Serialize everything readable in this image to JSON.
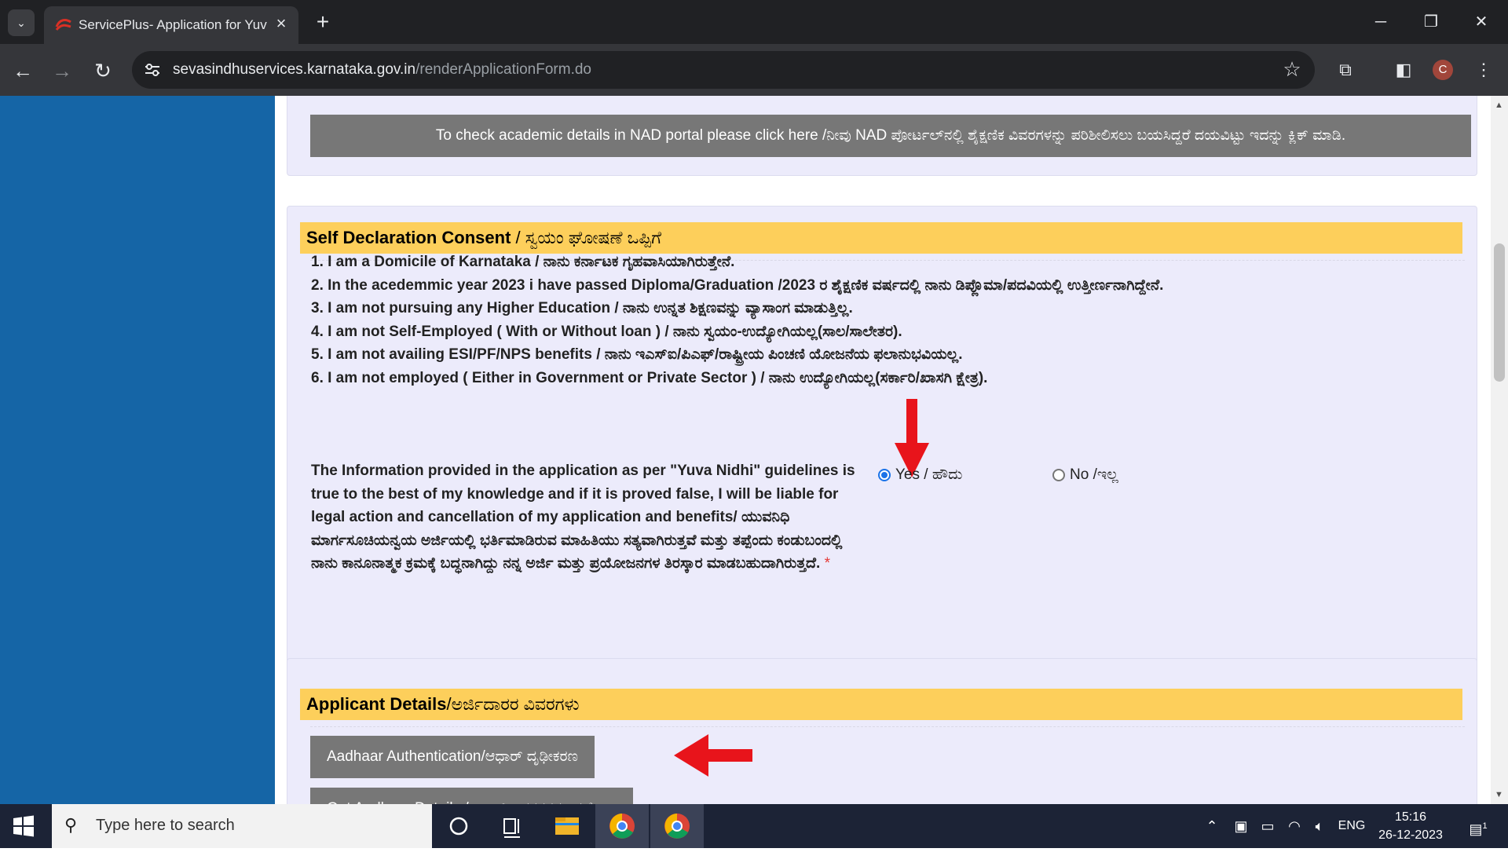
{
  "browser": {
    "tab_title": "ServicePlus- Application for Yuva Nidhi",
    "url_domain": "sevasindhuservices.karnataka.gov.in",
    "url_path": "/renderApplicationForm.do",
    "profile_initial": "C"
  },
  "nad": {
    "button_label": "To check academic details in NAD portal please click here /ನೀವು NAD ಪೋರ್ಟಲ್‌ನಲ್ಲಿ ಶೈಕ್ಷಣಿಕ ವಿವರಗಳನ್ನು ಪರಿಶೀಲಿಸಲು ಬಯಸಿದ್ದರೆ ದಯವಿಟ್ಟು ಇದನ್ನು ಕ್ಲಿಕ್ ಮಾಡಿ."
  },
  "declaration": {
    "title": "Self Declaration Consent",
    "subtitle": " / ಸ್ವಯಂ ಘೋಷಣೆ ಒಪ್ಪಿಗೆ",
    "items": [
      "1. I am a Domicile of Karnataka / ನಾನು ಕರ್ನಾಟಕ ಗೃಹವಾಸಿಯಾಗಿರುತ್ತೇನೆ.",
      "2. In the acedemmic year 2023 i have passed Diploma/Graduation /2023 ರ ಶೈಕ್ಷಣಿಕ ವರ್ಷದಲ್ಲಿ ನಾನು ಡಿಪ್ಲೊಮಾ/ಪದವಿಯಲ್ಲಿ ಉತ್ತೀರ್ಣನಾಗಿದ್ದೇನೆ.",
      "3. I am not pursuing any Higher Education / ನಾನು ಉನ್ನತ ಶಿಕ್ಷಣವನ್ನು ವ್ಯಾಸಾಂಗ ಮಾಡುತ್ತಿಲ್ಲ.",
      "4. I am not Self-Employed ( With or Without loan ) / ನಾನು ಸ್ವಯಂ-ಉದ್ಯೋಗಿಯಲ್ಲ(ಸಾಲ/ಸಾಲೇತರ).",
      "5. I am not availing ESI/PF/NPS benefits / ನಾನು ಇಎಸ್‌ಐ/ಪಿಎಫ್/ರಾಷ್ಟ್ರೀಯ ಪಿಂಚಣಿ ಯೋಜನೆಯ ಫಲಾನುಭವಿಯಲ್ಲ.",
      "6. I am not employed ( Either in Government or Private Sector ) / ನಾನು ಉದ್ಯೋಗಿಯಲ್ಲ(ಸರ್ಕಾರಿ/ಖಾಸಗಿ ಕ್ಷೇತ್ರ)."
    ],
    "info_text": "The Information provided in the application as per \"Yuva Nidhi\" guidelines is true to the best of my knowledge and if it is proved false, I will be liable for legal action and cancellation of my application and benefits/ ಯುವನಿಧಿ ಮಾರ್ಗಸೂಚಿಯನ್ವಯ ಅರ್ಜಿಯಲ್ಲಿ ಭರ್ತಿಮಾಡಿರುವ ಮಾಹಿತಿಯು ಸತ್ಯವಾಗಿರುತ್ತವೆ ಮತ್ತು ತಪ್ಪೆಂದು ಕಂಡುಬಂದಲ್ಲಿ ನಾನು ಕಾನೂನಾತ್ಮಕ ಕ್ರಮಕ್ಕೆ ಬದ್ಧನಾಗಿದ್ದು ನನ್ನ ಅರ್ಜಿ ಮತ್ತು ಪ್ರಯೋಜನಗಳ ತಿರಸ್ಕಾರ ಮಾಡಬಹುದಾಗಿರುತ್ತದೆ.",
    "required_mark": "*",
    "yes_label": "Yes / ಹೌದು",
    "no_label": "No /ಇಲ್ಲ",
    "selected": "yes"
  },
  "applicant": {
    "title": "Applicant Details",
    "subtitle": "/ಅರ್ಜಿದಾರರ ವಿವರಗಳು",
    "aadhaar_auth_label": "Aadhaar Authentication/ಆಧಾರ್ ದೃಢೀಕರಣ",
    "get_aadhaar_label": "Get Aadhaar Details /ಆಧಾರ್ ವಿವರಗಳನ್ನು ಪಡೆಯಿರಿ"
  },
  "taskbar": {
    "search_placeholder": "Type here to search",
    "language": "ENG",
    "time": "15:16",
    "date": "26-12-2023",
    "notification_count": "1"
  },
  "colors": {
    "sidebar": "#1565a6",
    "section_header": "#fdcf5b",
    "panel_bg": "#ecebfb",
    "button_gray": "#777777",
    "arrow_red": "#e8141b"
  }
}
